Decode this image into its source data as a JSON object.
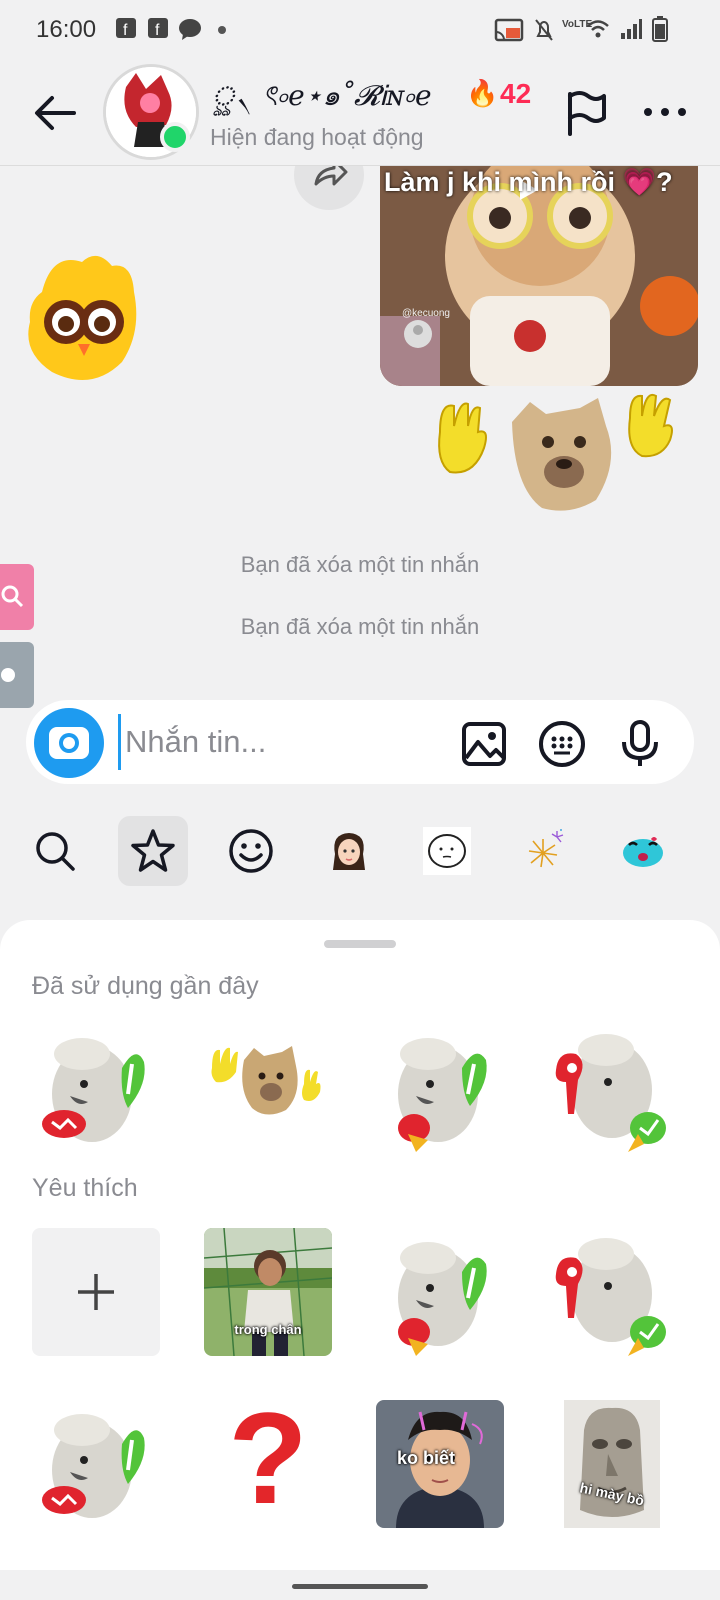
{
  "status_bar": {
    "time": "16:00",
    "network_label": "VoLTE"
  },
  "header": {
    "contact_name": "ৣ৲ ৎ৹e⋆๑˚𝓡Ꭵɴ৹e",
    "streak_count": "42",
    "presence": "Hiện đang hoạt động"
  },
  "chat": {
    "video_caption": "Làm j khi mình rồi 💗?",
    "video_author": "@kecuong",
    "deleted_1": "Bạn đã xóa một tin nhắn",
    "deleted_2": "Bạn đã xóa một tin nhắn"
  },
  "composer": {
    "placeholder": "Nhắn tin..."
  },
  "sticker_panel": {
    "recent_title": "Đã sử dụng gần đây",
    "favorites_title": "Yêu thích",
    "favorite_captions": {
      "boy": "trong chân",
      "ko_biet": "ko biết",
      "hi_may_bo": "hi mày bồ",
      "question": "?"
    }
  },
  "colors": {
    "accent": "#fe2c55",
    "camera": "#1e9bf0",
    "online": "#20d56a"
  }
}
